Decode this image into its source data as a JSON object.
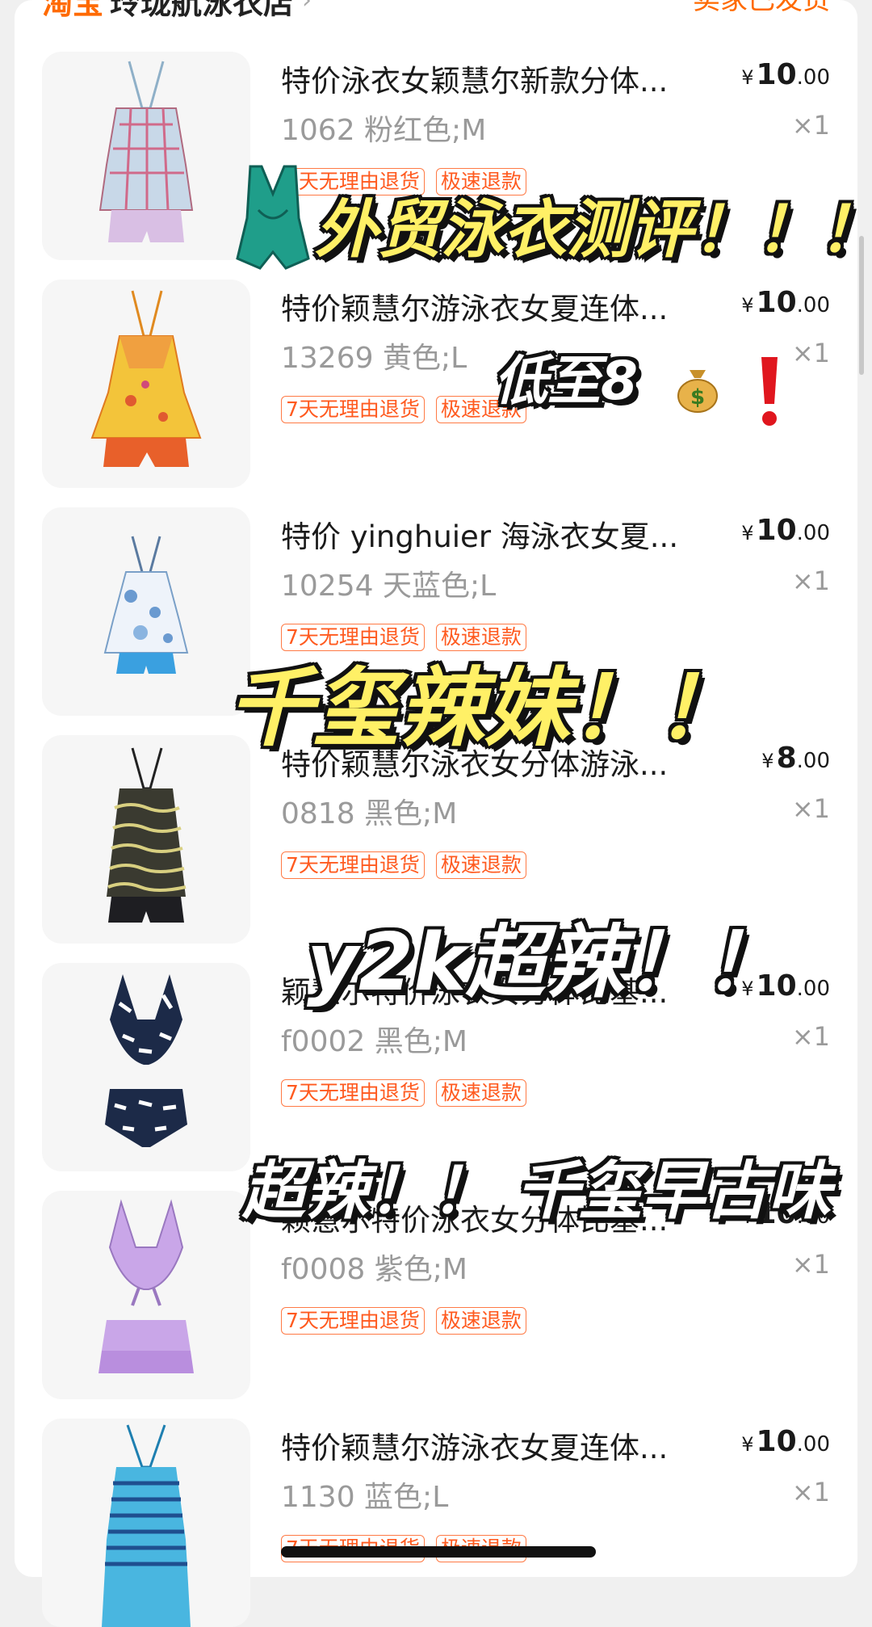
{
  "shop": {
    "platform": "淘宝",
    "name": "玲珑航泳衣店",
    "status": "卖家已发货"
  },
  "labels": {
    "currency": "¥",
    "qty_prefix": "×"
  },
  "items": [
    {
      "title": "特价泳衣女颖慧尔新款分体...",
      "price_int": "10",
      "price_dec": ".00",
      "variant": "1062 粉红色;M",
      "qty": "1",
      "tags": [
        "7天无理由退货",
        "极速退款"
      ]
    },
    {
      "title": "特价颖慧尔游泳衣女夏连体...",
      "price_int": "10",
      "price_dec": ".00",
      "variant": "13269 黄色;L",
      "qty": "1",
      "tags": [
        "7天无理由退货",
        "极速退款"
      ]
    },
    {
      "title": "特价 yinghuier 海泳衣女夏...",
      "price_int": "10",
      "price_dec": ".00",
      "variant": "10254 天蓝色;L",
      "qty": "1",
      "tags": [
        "7天无理由退货",
        "极速退款"
      ]
    },
    {
      "title": "特价颖慧尔泳衣女分体游泳...",
      "price_int": "8",
      "price_dec": ".00",
      "variant": "0818 黑色;M",
      "qty": "1",
      "tags": [
        "7天无理由退货",
        "极速退款"
      ]
    },
    {
      "title": "颖慧尔特价泳衣女分体比基...",
      "price_int": "10",
      "price_dec": ".00",
      "variant": "f0002 黑色;M",
      "qty": "1",
      "tags": [
        "7天无理由退货",
        "极速退款"
      ]
    },
    {
      "title": "颖慧尔特价泳衣女分体比基...",
      "price_int": "10",
      "price_dec": ".00",
      "variant": "f0008 紫色;M",
      "qty": "1",
      "tags": [
        "7天无理由退货",
        "极速退款"
      ]
    },
    {
      "title": "特价颖慧尔游泳衣女夏连体...",
      "price_int": "10",
      "price_dec": ".00",
      "variant": "1130 蓝色;L",
      "qty": "1",
      "tags": [
        "7天无理由退货",
        "极速退款"
      ]
    }
  ],
  "overlays": {
    "headline": "外贸泳衣测评！！！",
    "low_price": "低至8",
    "millennium": "千玺辣妹！！",
    "y2k": "y2k超辣！！",
    "hot": "超辣！！ 千玺早古味"
  },
  "colors": {
    "accent": "#ff6a00",
    "overlay_text": "#fff066"
  },
  "icons": [
    "chevron-right-icon",
    "swimsuit-sticker-icon",
    "money-bag-icon",
    "exclamation-icon"
  ]
}
